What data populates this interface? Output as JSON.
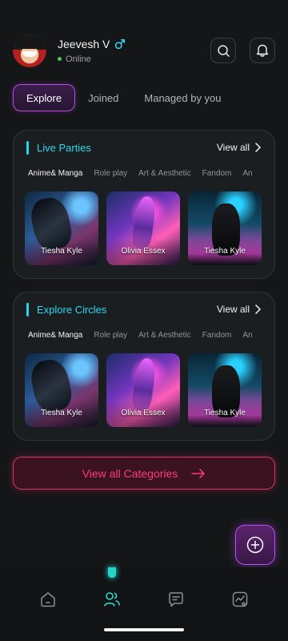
{
  "user": {
    "name": "Jeevesh V",
    "status": "Online",
    "avatar_icon": "avatar-icon",
    "gender_icon": "male-icon",
    "status_color": "#35d05c"
  },
  "header_actions": {
    "search_icon": "search-icon",
    "bell_icon": "bell-icon"
  },
  "tabs": [
    {
      "label": "Explore"
    },
    {
      "label": "Joined"
    },
    {
      "label": "Managed by you"
    }
  ],
  "sections": [
    {
      "title": "Live Parties",
      "view_all": "View all",
      "categories": [
        "Anime& Manga",
        "Role play",
        "Art & Aesthetic",
        "Fandom",
        "An"
      ],
      "cards": [
        {
          "name": "Tiesha Kyle"
        },
        {
          "name": "Olivia Essex"
        },
        {
          "name": "Tiesha Kyle"
        }
      ]
    },
    {
      "title": "Explore Circles",
      "view_all": "View all",
      "categories": [
        "Anime& Manga",
        "Role play",
        "Art & Aesthetic",
        "Fandom",
        "An"
      ],
      "cards": [
        {
          "name": "Tiesha Kyle"
        },
        {
          "name": "Olivia Essex"
        },
        {
          "name": "Tiesha Kyle"
        }
      ]
    }
  ],
  "cta": {
    "label": "View all Categories",
    "icon": "arrow-right-icon"
  },
  "fab": {
    "icon": "plus-icon"
  },
  "bottom_nav": {
    "items": [
      {
        "icon": "home-icon"
      },
      {
        "icon": "community-icon"
      },
      {
        "icon": "messages-icon"
      },
      {
        "icon": "activity-icon"
      }
    ],
    "active_index": 1
  },
  "colors": {
    "accent_purple": "#b44ce3",
    "accent_cyan": "#21d6ef",
    "accent_pink": "#ff3b78",
    "active_nav": "#26d5c5"
  }
}
